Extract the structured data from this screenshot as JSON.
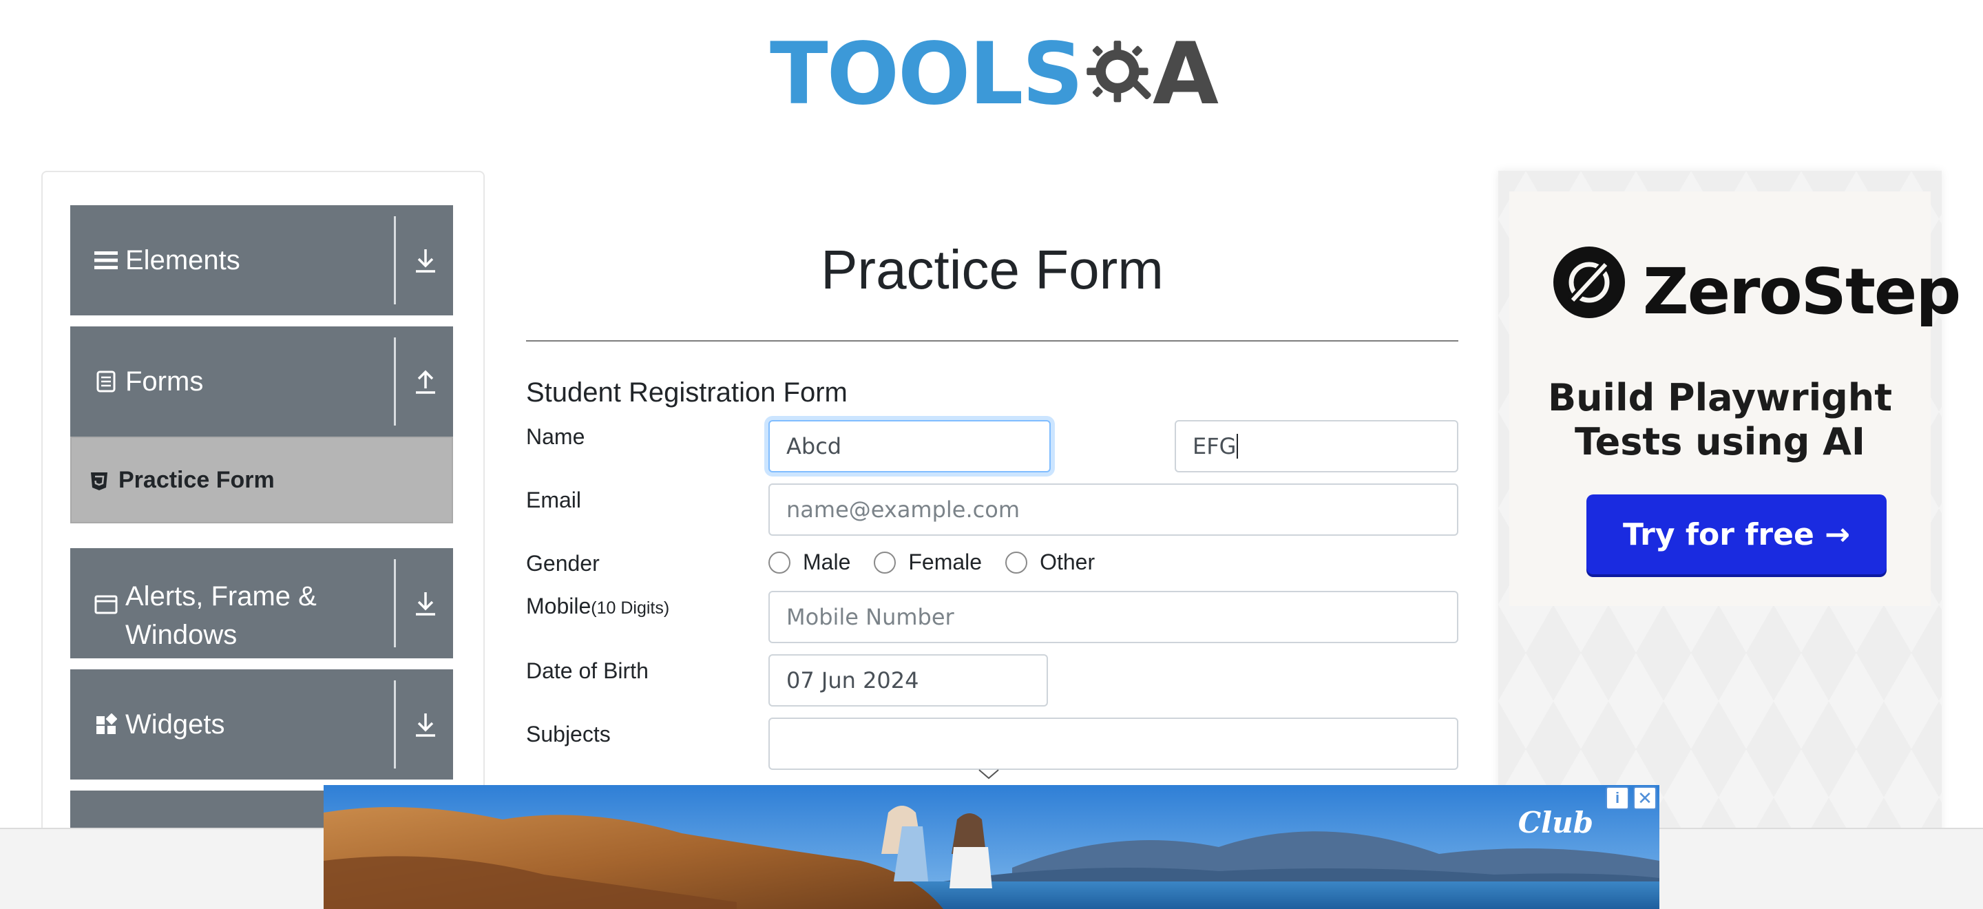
{
  "header": {
    "logo_tools": "TOOLS",
    "logo_qa": "A"
  },
  "sidebar": {
    "groups": [
      {
        "label": "Elements",
        "icon": "hamburger-icon",
        "toggle": "download-icon"
      },
      {
        "label": "Forms",
        "icon": "document-icon",
        "toggle": "upload-icon",
        "items": [
          {
            "label": "Practice Form",
            "icon": "html5-icon",
            "active": true
          }
        ]
      },
      {
        "label": "Alerts, Frame &",
        "label2": "Windows",
        "icon": "window-icon",
        "toggle": "download-icon"
      },
      {
        "label": "Widgets",
        "icon": "widgets-icon",
        "toggle": "download-icon"
      }
    ]
  },
  "form": {
    "page_title": "Practice Form",
    "form_title": "Student Registration Form",
    "name_label": "Name",
    "first_name_value": "Abcd",
    "last_name_value": "EFG",
    "email_label": "Email",
    "email_placeholder": "name@example.com",
    "gender_label": "Gender",
    "gender_options": [
      "Male",
      "Female",
      "Other"
    ],
    "mobile_label": "Mobile",
    "mobile_hint": "(10 Digits)",
    "mobile_placeholder": "Mobile Number",
    "dob_label": "Date of Birth",
    "dob_value": "07 Jun 2024",
    "subjects_label": "Subjects",
    "subjects_value": ""
  },
  "ad_right": {
    "brand": "ZeroStep",
    "tagline_line1": "Build Playwright",
    "tagline_line2": "Tests using AI",
    "cta": "Try for free →",
    "cta_color": "#1a2be0"
  },
  "ad_bottom": {
    "brand": "Club",
    "info_icon": "info-icon",
    "close_icon": "close-icon"
  },
  "colors": {
    "sidebar_group": "#6c757d",
    "sidebar_active": "#b5b5b5",
    "logo_blue": "#3c99d8",
    "logo_dark": "#4a4a4a",
    "focus_border": "#80bdff"
  }
}
